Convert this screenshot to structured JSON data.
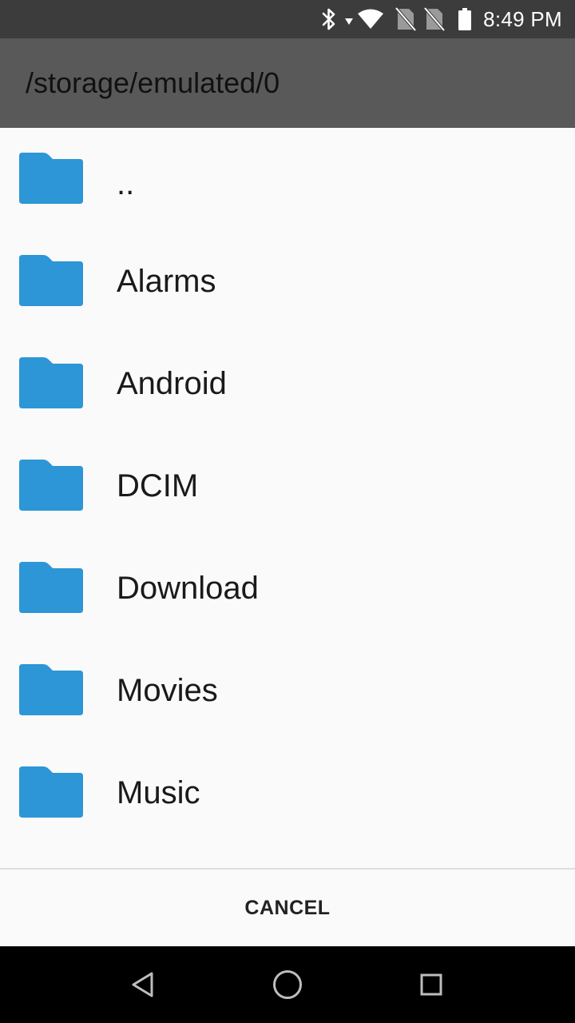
{
  "status_bar": {
    "time": "8:49 PM",
    "icons": [
      "bluetooth-icon",
      "data-arrow-icon",
      "wifi-icon",
      "no-sim-icon",
      "no-sim-icon",
      "battery-icon"
    ]
  },
  "header": {
    "path": "/storage/emulated/0"
  },
  "folders": [
    {
      "label": "..",
      "icon": "folder-icon"
    },
    {
      "label": "Alarms",
      "icon": "folder-icon"
    },
    {
      "label": "Android",
      "icon": "folder-icon"
    },
    {
      "label": "DCIM",
      "icon": "folder-icon"
    },
    {
      "label": "Download",
      "icon": "folder-icon"
    },
    {
      "label": "Movies",
      "icon": "folder-icon"
    },
    {
      "label": "Music",
      "icon": "folder-icon"
    }
  ],
  "actions": {
    "cancel_label": "CANCEL"
  },
  "nav_bar": {
    "buttons": [
      "back-icon",
      "home-icon",
      "recents-icon"
    ]
  },
  "colors": {
    "folder": "#2d96d6",
    "status_bar": "#3c3c3c",
    "app_bar": "#595959",
    "background": "#fafafa"
  }
}
